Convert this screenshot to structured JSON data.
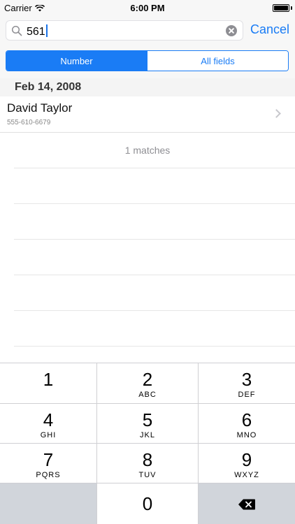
{
  "status_bar": {
    "carrier": "Carrier",
    "time": "6:00 PM",
    "battery_level": 1.0
  },
  "search": {
    "value": "561",
    "cancel_label": "Cancel"
  },
  "segments": {
    "items": [
      "Number",
      "All fields"
    ],
    "selected": 0
  },
  "results": {
    "section_date": "Feb 14, 2008",
    "rows": [
      {
        "name": "David Taylor",
        "number": "555-610-6679"
      }
    ],
    "match_count_text": "1 matches"
  },
  "keypad": {
    "keys": [
      {
        "digit": "1",
        "letters": ""
      },
      {
        "digit": "2",
        "letters": "ABC"
      },
      {
        "digit": "3",
        "letters": "DEF"
      },
      {
        "digit": "4",
        "letters": "GHI"
      },
      {
        "digit": "5",
        "letters": "JKL"
      },
      {
        "digit": "6",
        "letters": "MNO"
      },
      {
        "digit": "7",
        "letters": "PQRS"
      },
      {
        "digit": "8",
        "letters": "TUV"
      },
      {
        "digit": "9",
        "letters": "WXYZ"
      },
      {
        "digit": "0",
        "letters": ""
      }
    ],
    "delete_icon": "backspace-icon"
  },
  "colors": {
    "accent": "#1a7cf5",
    "key_gray": "#d1d5db"
  }
}
